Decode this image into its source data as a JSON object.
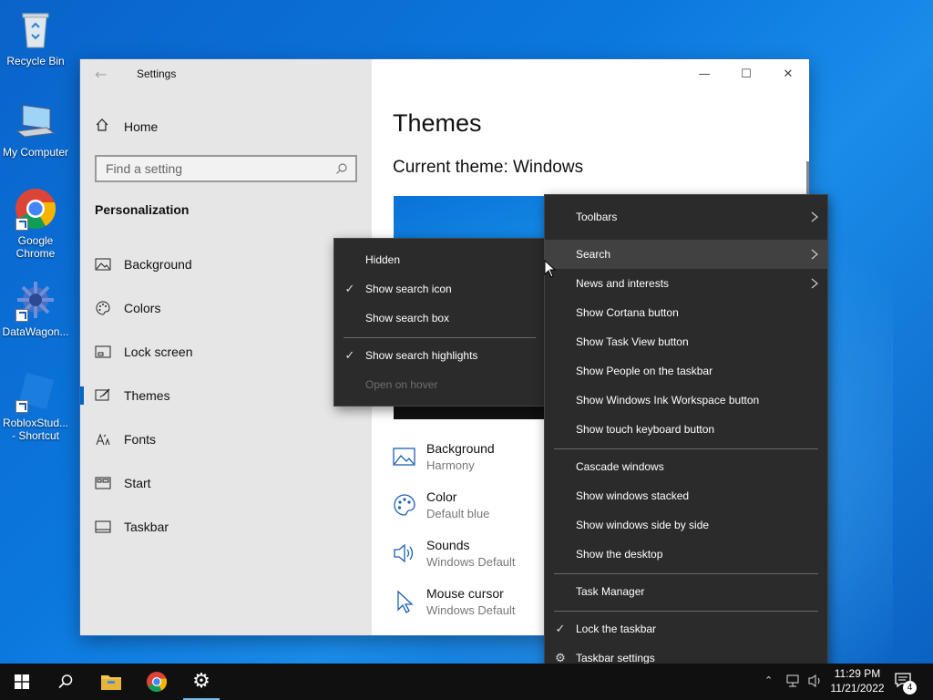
{
  "desktop": {
    "icons": [
      {
        "label": "Recycle Bin",
        "icon": "recycle-bin-icon"
      },
      {
        "label": "My Computer",
        "icon": "computer-icon"
      },
      {
        "label": "Google Chrome",
        "icon": "chrome-icon"
      },
      {
        "label": "DataWagon...",
        "icon": "datawagon-icon"
      },
      {
        "label": "RobloxStud... - Shortcut",
        "icon": "roblox-studio-icon"
      }
    ]
  },
  "window": {
    "title": "Settings",
    "sidebar": {
      "home_label": "Home",
      "search_placeholder": "Find a setting",
      "section_title": "Personalization",
      "items": [
        {
          "label": "Background",
          "icon": "picture-icon"
        },
        {
          "label": "Colors",
          "icon": "palette-icon"
        },
        {
          "label": "Lock screen",
          "icon": "lock-screen-icon"
        },
        {
          "label": "Themes",
          "icon": "brush-icon",
          "active": true
        },
        {
          "label": "Fonts",
          "icon": "fonts-icon"
        },
        {
          "label": "Start",
          "icon": "start-icon"
        },
        {
          "label": "Taskbar",
          "icon": "taskbar-icon"
        }
      ]
    },
    "content": {
      "page_title": "Themes",
      "current_theme": "Current theme: Windows",
      "properties": [
        {
          "title": "Background",
          "value": "Harmony",
          "icon": "picture-icon"
        },
        {
          "title": "Color",
          "value": "Default blue",
          "icon": "palette-icon"
        },
        {
          "title": "Sounds",
          "value": "Windows Default",
          "icon": "speaker-icon"
        },
        {
          "title": "Mouse cursor",
          "value": "Windows Default",
          "icon": "cursor-icon"
        }
      ]
    }
  },
  "search_submenu": {
    "items": [
      {
        "label": "Hidden",
        "checked": false,
        "disabled": false
      },
      {
        "label": "Show search icon",
        "checked": true,
        "disabled": false
      },
      {
        "label": "Show search box",
        "checked": false,
        "disabled": false
      },
      {
        "label": "Show search highlights",
        "checked": true,
        "disabled": false
      },
      {
        "label": "Open on hover",
        "checked": false,
        "disabled": true
      }
    ]
  },
  "taskbar_menu": {
    "items": [
      {
        "label": "Toolbars",
        "submenu": true
      },
      {
        "label": "Search",
        "submenu": true,
        "hover": true
      },
      {
        "label": "News and interests",
        "submenu": true
      },
      {
        "label": "Show Cortana button"
      },
      {
        "label": "Show Task View button"
      },
      {
        "label": "Show People on the taskbar"
      },
      {
        "label": "Show Windows Ink Workspace button"
      },
      {
        "label": "Show touch keyboard button"
      },
      {
        "label": "Cascade windows"
      },
      {
        "label": "Show windows stacked"
      },
      {
        "label": "Show windows side by side"
      },
      {
        "label": "Show the desktop"
      },
      {
        "label": "Task Manager"
      },
      {
        "label": "Lock the taskbar",
        "checked": true
      },
      {
        "label": "Taskbar settings",
        "icon": "gear-icon"
      }
    ]
  },
  "taskbar": {
    "time": "11:29 PM",
    "date": "11/21/2022",
    "notification_count": "4",
    "accent": "#76b9ed"
  }
}
